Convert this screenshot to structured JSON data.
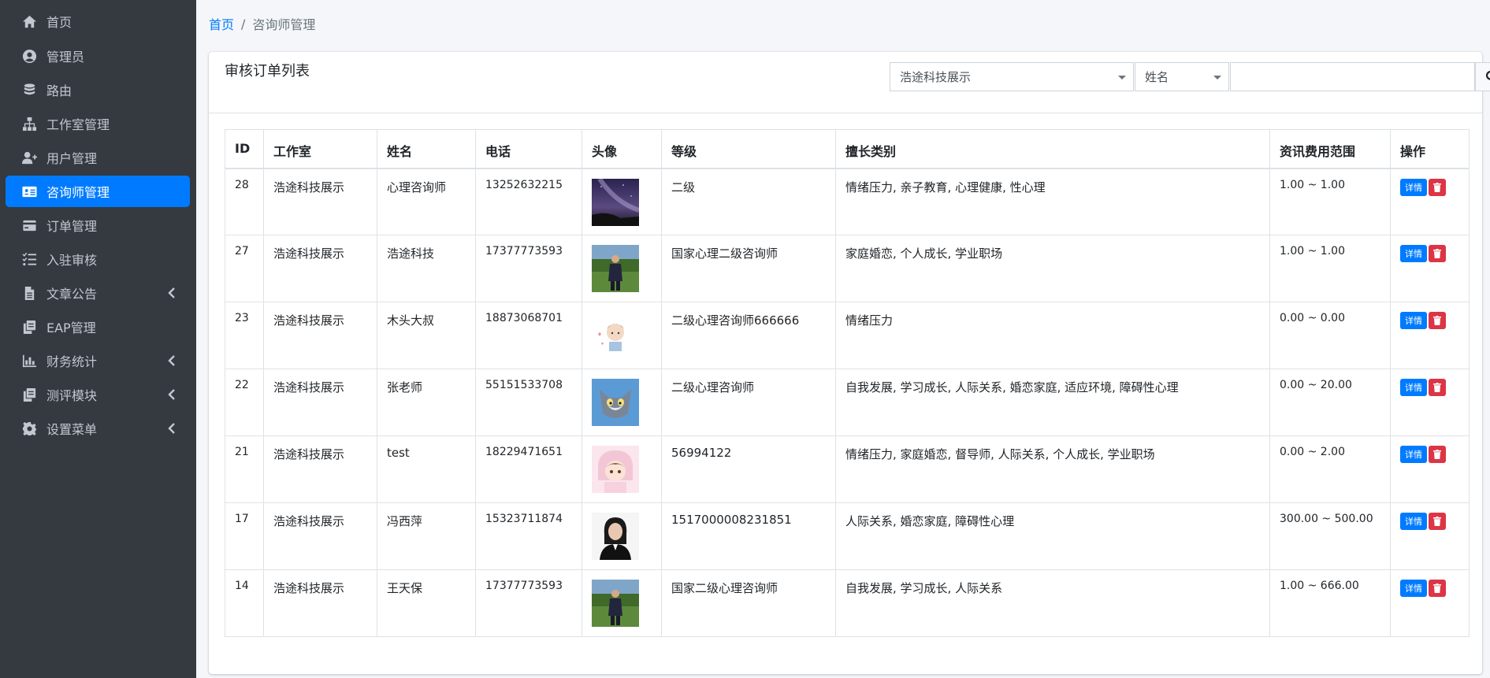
{
  "sidebar": {
    "items": [
      {
        "label": "首页",
        "icon": "home-icon"
      },
      {
        "label": "管理员",
        "icon": "user-circle-icon"
      },
      {
        "label": "路由",
        "icon": "database-icon"
      },
      {
        "label": "工作室管理",
        "icon": "sitemap-icon"
      },
      {
        "label": "用户管理",
        "icon": "user-plus-icon"
      },
      {
        "label": "咨询师管理",
        "icon": "id-card-icon",
        "active": true
      },
      {
        "label": "订单管理",
        "icon": "credit-card-icon"
      },
      {
        "label": "入驻审核",
        "icon": "tasks-icon"
      },
      {
        "label": "文章公告",
        "icon": "file-icon",
        "has_arrow": true
      },
      {
        "label": "EAP管理",
        "icon": "copy-icon"
      },
      {
        "label": "财务统计",
        "icon": "chart-bar-icon",
        "has_arrow": true
      },
      {
        "label": "测评模块",
        "icon": "copy-icon",
        "has_arrow": true
      },
      {
        "label": "设置菜单",
        "icon": "gear-icon",
        "has_arrow": true
      }
    ]
  },
  "breadcrumb": {
    "home": "首页",
    "separator": "/",
    "current": "咨询师管理"
  },
  "card": {
    "title": "审核订单列表"
  },
  "filters": {
    "studio_select": "浩途科技展示",
    "field_select": "姓名",
    "search_value": ""
  },
  "table": {
    "headers": [
      "ID",
      "工作室",
      "姓名",
      "电话",
      "头像",
      "等级",
      "擅长类别",
      "资讯费用范围",
      "操作"
    ],
    "rows": [
      {
        "id": "28",
        "studio": "浩途科技展示",
        "name": "心理咨询师",
        "phone": "13252632215",
        "level": "二级",
        "specialty": "情绪压力, 亲子教育, 心理健康, 性心理",
        "fee": "1.00 ~ 1.00"
      },
      {
        "id": "27",
        "studio": "浩途科技展示",
        "name": "浩途科技",
        "phone": "17377773593",
        "level": "国家心理二级咨询师",
        "specialty": "家庭婚恋, 个人成长, 学业职场",
        "fee": "1.00 ~ 1.00"
      },
      {
        "id": "23",
        "studio": "浩途科技展示",
        "name": "木头大叔",
        "phone": "18873068701",
        "level": "二级心理咨询师666666",
        "specialty": "情绪压力",
        "fee": "0.00 ~ 0.00"
      },
      {
        "id": "22",
        "studio": "浩途科技展示",
        "name": "张老师",
        "phone": "55151533708",
        "level": "二级心理咨询师",
        "specialty": "自我发展, 学习成长, 人际关系, 婚恋家庭, 适应环境, 障碍性心理",
        "fee": "0.00 ~ 20.00"
      },
      {
        "id": "21",
        "studio": "浩途科技展示",
        "name": "test",
        "phone": "18229471651",
        "level": "56994122",
        "specialty": "情绪压力, 家庭婚恋, 督导师, 人际关系, 个人成长, 学业职场",
        "fee": "0.00 ~ 2.00"
      },
      {
        "id": "17",
        "studio": "浩途科技展示",
        "name": "冯西萍",
        "phone": "15323711874",
        "level": "1517000008231851",
        "specialty": "人际关系, 婚恋家庭, 障碍性心理",
        "fee": "300.00 ~ 500.00"
      },
      {
        "id": "14",
        "studio": "浩途科技展示",
        "name": "王天保",
        "phone": "17377773593",
        "level": "国家二级心理咨询师",
        "specialty": "自我发展, 学习成长, 人际关系",
        "fee": "1.00 ~ 666.00"
      }
    ],
    "detail_label": "详情"
  },
  "colors": {
    "sidebar_bg": "#343a40",
    "accent": "#007bff",
    "danger": "#dc3545"
  }
}
